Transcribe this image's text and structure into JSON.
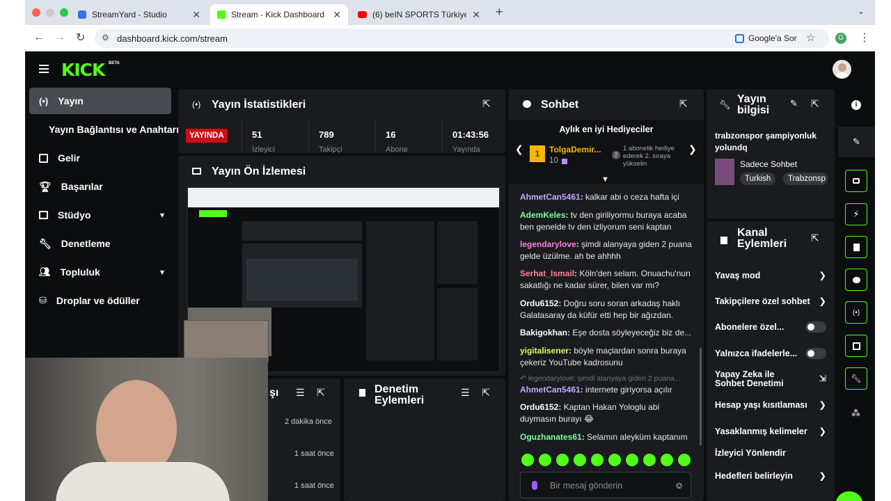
{
  "browser": {
    "tabs": [
      {
        "title": "StreamYard - Studio",
        "favicon_color": "#3b6ee8"
      },
      {
        "title": "Stream - Kick Dashboard",
        "favicon_color": "#53fc18"
      },
      {
        "title": "(6) beIN SPORTS Türkiye - Yo",
        "favicon_color": "#ff0000"
      }
    ],
    "new_tab": "+",
    "url": "dashboard.kick.com/stream",
    "google_btn": "Google'a Sor",
    "profile_letter": "G"
  },
  "kick": {
    "logo": "KICK",
    "beta": "BETA",
    "accent": "#53fc18"
  },
  "sidebar": {
    "items": [
      {
        "label": "Yayın",
        "icon": "broadcast-icon",
        "active": true
      },
      {
        "label": "Yayın Bağlantısı ve Anahtarı",
        "icon": "",
        "active": false
      },
      {
        "label": "Gelir",
        "icon": "chart-icon",
        "active": false
      },
      {
        "label": "Başarılar",
        "icon": "trophy-icon",
        "active": false
      },
      {
        "label": "Stüdyo",
        "icon": "studio-icon",
        "active": false,
        "expandable": true
      },
      {
        "label": "Denetleme",
        "icon": "wrench-icon",
        "active": false
      },
      {
        "label": "Topluluk",
        "icon": "community-icon",
        "active": false,
        "expandable": true
      },
      {
        "label": "Droplar ve ödüller",
        "icon": "drops-icon",
        "active": false
      }
    ]
  },
  "stats": {
    "title": "Yayın İstatistikleri",
    "live_badge": "YAYINDA",
    "columns": [
      {
        "value": "51",
        "label": "İzleyici"
      },
      {
        "value": "789",
        "label": "Takipçi"
      },
      {
        "value": "16",
        "label": "Abone"
      },
      {
        "value": "01:43:56",
        "label": "Yayında"
      }
    ]
  },
  "preview": {
    "title": "Yayın Ön İzlemesi"
  },
  "activity": {
    "title_partial": "şı",
    "times": [
      "2 dakika önce",
      "1 saat önce",
      "1 saat önce"
    ]
  },
  "modactions": {
    "title": "Denetim Eylemleri"
  },
  "chat": {
    "title": "Sohbet",
    "gifters_title": "Aylık en iyi Hediyeciler",
    "top_gifter": {
      "rank": "1",
      "name": "TolgaDemir...",
      "count": "10"
    },
    "next_gifter_rank": "2",
    "next_gifter_text": "1 abonelik hediye ederek 2. sıraya yükselin",
    "messages": [
      {
        "user": "AhmetCan5461",
        "color": "#c8a7ff",
        "text": "kalkar abi o ceza hafta içi"
      },
      {
        "user": "AdemKeles",
        "color": "#7dffa0",
        "text": "tv den giriliyormu buraya acaba ben genelde tv den izliyorum seni kaptan"
      },
      {
        "user": "legendarylove",
        "color": "#ff7de0",
        "text": "şimdi alanyaya giden 2 puana gelde üzülme. ah be ahhhh"
      },
      {
        "user": "Serhat_Ismail",
        "color": "#ff7f9e",
        "text": "Köln'den selam. Onuachu'nun sakatlığı ne kadar sürer, bilen var mı?"
      },
      {
        "user": "Ordu6152",
        "color": "#ffffff",
        "text": "Doğru soru soran arkadaş haklı Galatasaray da küfür etti hep bir ağızdan."
      },
      {
        "user": "Bakigokhan",
        "color": "#ffffff",
        "text": "Eşe dosta söyleyeceğiz biz de..."
      },
      {
        "user": "yigitalisener",
        "color": "#d4ff5e",
        "text": "böyle maçlardan sonra buraya çekeriz YouTube kadrosunu"
      },
      {
        "user": "AhmetCan5461",
        "color": "#c8a7ff",
        "text": "internete giriyorsa açılır"
      },
      {
        "user": "Ordu6152",
        "color": "#ffffff",
        "text": "Kaptan Hakan Yologlu abi duymasın burayı 😂"
      },
      {
        "user": "Oguzhanates61",
        "color": "#7dffa0",
        "text": "Selamın aleyküm kaptanım"
      }
    ],
    "reply_preview": "legendarylove: şimdi alanyaya giden 2 puana...",
    "input_placeholder": "Bir mesaj gönderin"
  },
  "stream_info": {
    "title": "Yayın bilgisi",
    "stream_title": "trabzonspor şampiyonluk yolundq",
    "category": "Sadece Sohbet",
    "tags": [
      "Turkish",
      "Trabzonsp"
    ]
  },
  "channel_actions": {
    "title": "Kanal Eylemleri",
    "items": [
      {
        "label": "Yavaş mod",
        "control": "chevron"
      },
      {
        "label": "Takipçilere özel sohbet",
        "control": "chevron"
      },
      {
        "label": "Abonelere özel...",
        "control": "toggle"
      },
      {
        "label": "Yalnızca ifadelerle...",
        "control": "toggle"
      },
      {
        "label": "Yapay Zeka ile Sohbet Denetimi",
        "control": "external"
      },
      {
        "label": "Hesap yaşı kısıtlaması",
        "control": "chevron"
      },
      {
        "label": "Yasaklanmış kelimeler",
        "control": "chevron"
      },
      {
        "label": "İzleyici Yönlendir",
        "control": "none"
      },
      {
        "label": "Hedefleri belirleyin",
        "control": "chevron"
      }
    ]
  }
}
